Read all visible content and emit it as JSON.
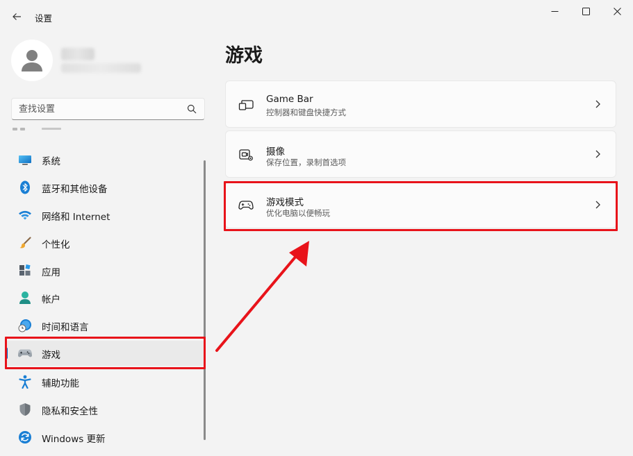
{
  "window": {
    "title": "设置",
    "controls": {
      "minimize": "minimize-icon",
      "maximize": "maximize-icon",
      "close": "close-icon"
    }
  },
  "profile": {
    "name": " ",
    "email": " "
  },
  "search": {
    "placeholder": "查找设置"
  },
  "sidebar": {
    "items": [
      {
        "label": "系统",
        "icon": "system-icon"
      },
      {
        "label": "蓝牙和其他设备",
        "icon": "bluetooth-icon"
      },
      {
        "label": "网络和 Internet",
        "icon": "wifi-icon"
      },
      {
        "label": "个性化",
        "icon": "brush-icon"
      },
      {
        "label": "应用",
        "icon": "apps-icon"
      },
      {
        "label": "帐户",
        "icon": "account-icon"
      },
      {
        "label": "时间和语言",
        "icon": "time-language-icon"
      },
      {
        "label": "游戏",
        "icon": "gamepad-icon",
        "selected": true
      },
      {
        "label": "辅助功能",
        "icon": "accessibility-icon"
      },
      {
        "label": "隐私和安全性",
        "icon": "shield-icon"
      },
      {
        "label": "Windows 更新",
        "icon": "update-icon"
      }
    ]
  },
  "main": {
    "title": "游戏",
    "cards": [
      {
        "title": "Game Bar",
        "subtitle": "控制器和键盘快捷方式",
        "icon": "game-bar-icon"
      },
      {
        "title": "摄像",
        "subtitle": "保存位置，录制首选项",
        "icon": "capture-icon"
      },
      {
        "title": "游戏模式",
        "subtitle": "优化电脑以便畅玩",
        "icon": "game-mode-icon"
      }
    ]
  },
  "colors": {
    "accent": "#005fb8",
    "highlight": "#e8131a",
    "background": "#f3f3f3",
    "card": "#fbfbfb"
  }
}
